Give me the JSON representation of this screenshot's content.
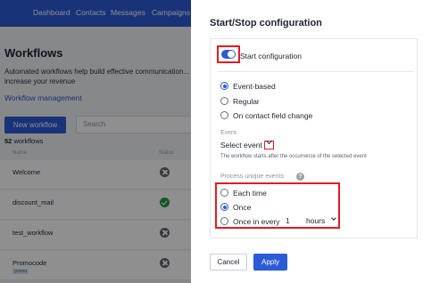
{
  "nav": {
    "items": [
      "Dashboard",
      "Contacts",
      "Messages",
      "Campaigns"
    ]
  },
  "page": {
    "title": "Workflows",
    "description": "Automated workflows help build effective communication... increase your revenue",
    "link": "Workflow management",
    "new_button": "New workflow",
    "search_placeholder": "Search",
    "count_number": "52",
    "count_label": "workflows",
    "columns": {
      "name": "Name",
      "status": "Status"
    },
    "rows": [
      {
        "name": "Welcome",
        "status": "off"
      },
      {
        "name": "discount_mail",
        "status": "on"
      },
      {
        "name": "test_workflow",
        "status": "off"
      },
      {
        "name": "Promocode",
        "status": "off",
        "tag": "promo"
      }
    ]
  },
  "panel": {
    "title": "Start/Stop configuration",
    "start_toggle": {
      "label": "Start configuration",
      "on": true
    },
    "trigger_options": [
      {
        "label": "Event-based",
        "checked": true
      },
      {
        "label": "Regular",
        "checked": false
      },
      {
        "label": "On contact field change",
        "checked": false
      }
    ],
    "event_label": "Event",
    "event_select": "Select event",
    "event_help": "The workflow starts after the occurrence of the selected event",
    "unique_label": "Process unique events:",
    "unique_options": [
      {
        "label": "Each time",
        "checked": false
      },
      {
        "label": "Once",
        "checked": true
      },
      {
        "label": "Once in every",
        "checked": false
      }
    ],
    "interval_value": "1",
    "interval_unit": "hours",
    "cancel": "Cancel",
    "apply": "Apply"
  },
  "colors": {
    "accent": "#2b5bd7",
    "highlight": "#e11b22",
    "success": "#1f9d43"
  }
}
